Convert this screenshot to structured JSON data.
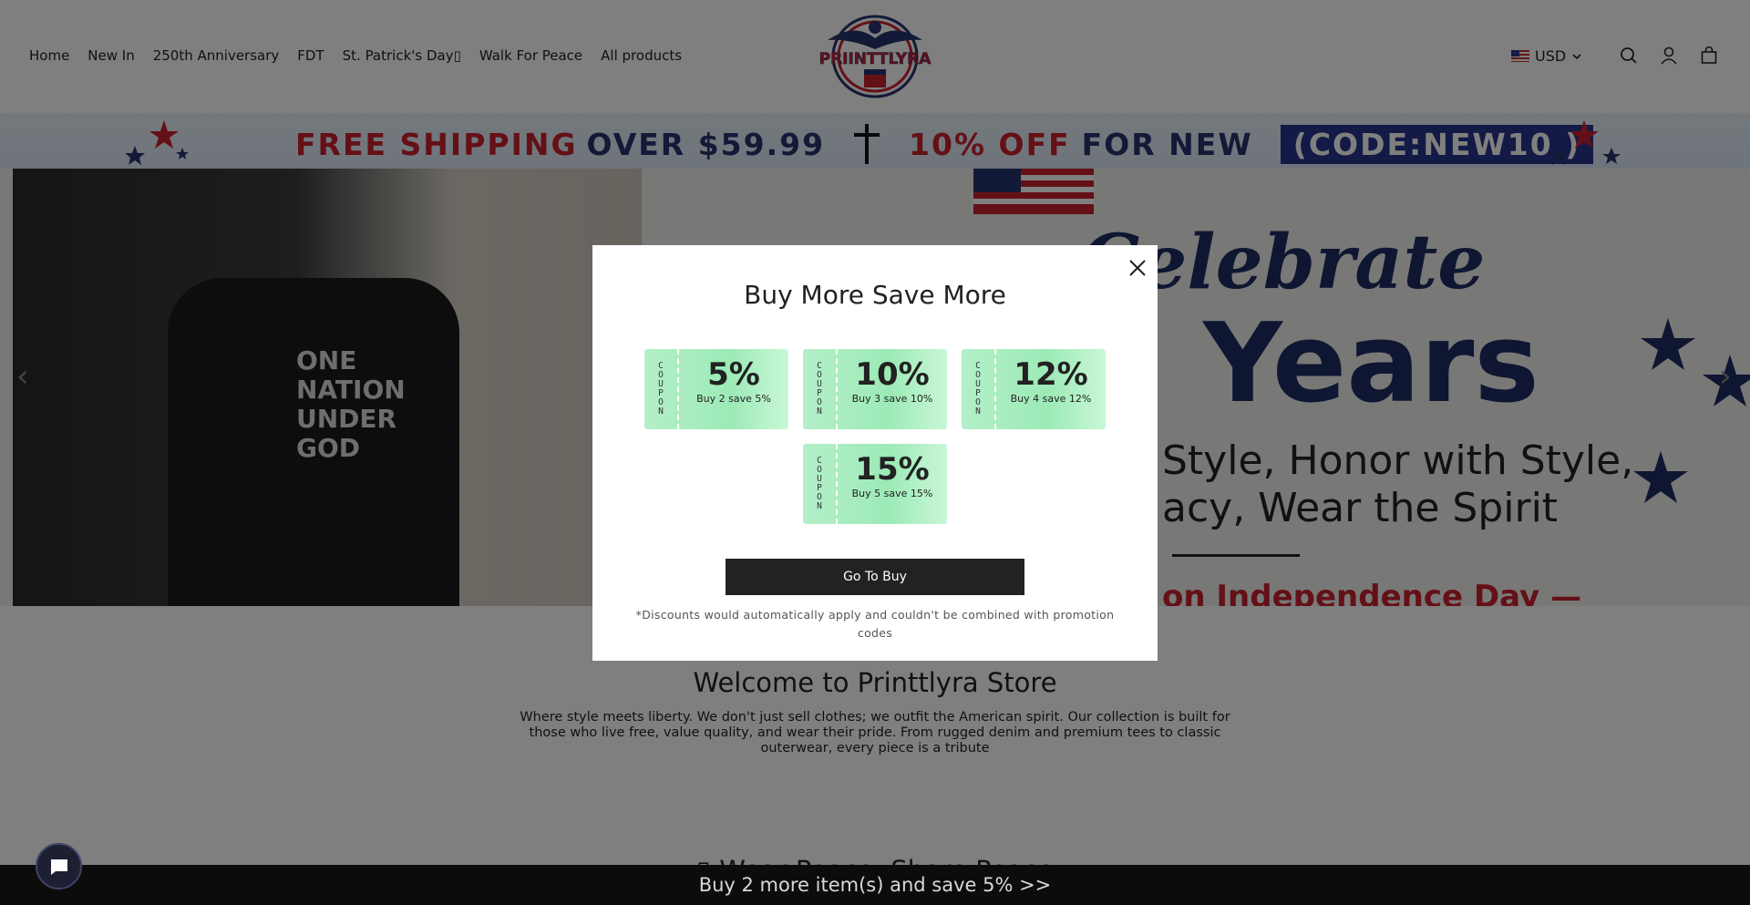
{
  "header": {
    "nav": [
      "Home",
      "New In",
      "250th Anniversary",
      "FDT",
      "St. Patrick's Day▯",
      "Walk For Peace",
      "All products"
    ],
    "logo_text": "PRIINTTLYRA",
    "currency": "USD"
  },
  "promo": {
    "free_shipping": "FREE SHIPPING",
    "over": "OVER $59.99",
    "discount": "10% OFF",
    "for_new": "FOR NEW",
    "code": "(CODE:NEW10 )"
  },
  "hero": {
    "title1": "Celebrate",
    "title2": "Years",
    "sub1": "Style, Honor with Style,",
    "sub2": "acy, Wear the Spirit",
    "footer": "on Independence Day —",
    "shirt_text": "ONE NATION UNDER GOD"
  },
  "welcome": {
    "title": "Welcome to Printtlyra Store",
    "text": "Where style meets liberty. We don't just sell clothes; we outfit the American spirit. Our collection is built for those who live free, value quality, and wear their pride. From rugged denim and premium tees to classic outerwear, every piece is a tribute",
    "next_heading": "▯ Wear Peace, Share Peace"
  },
  "modal": {
    "title": "Buy More Save More",
    "coupon_label": "COUPON",
    "coupons": [
      {
        "pct": "5%",
        "desc": "Buy 2 save 5%"
      },
      {
        "pct": "10%",
        "desc": "Buy 3 save 10%"
      },
      {
        "pct": "12%",
        "desc": "Buy 4 save 12%"
      },
      {
        "pct": "15%",
        "desc": "Buy 5 save 15%"
      }
    ],
    "button": "Go To Buy",
    "disclaimer": "*Discounts would automatically apply and couldn't be combined with promotion codes"
  },
  "bottom_bar": {
    "text": "Buy 2 more item(s) and save 5%  >>"
  },
  "colors": {
    "accent_red": "#c8202f",
    "accent_blue": "#27356f",
    "coupon_green": "#9ceab6",
    "button_dark": "#222222"
  }
}
